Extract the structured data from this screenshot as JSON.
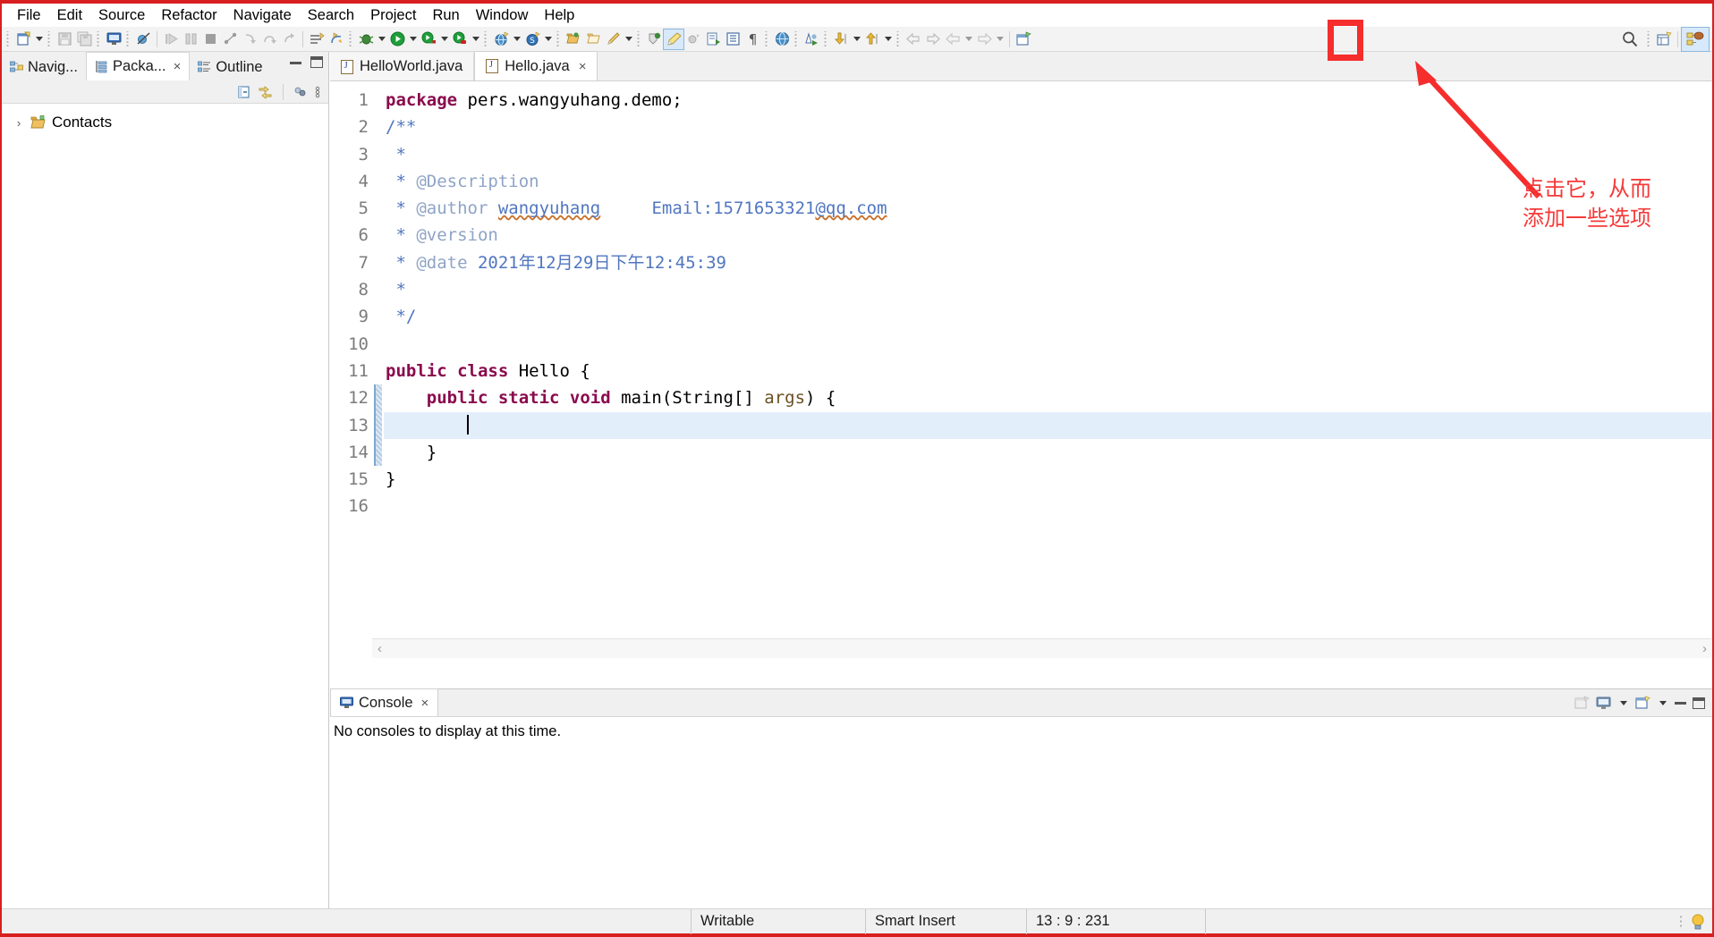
{
  "window": {
    "accent_border_color": "#d81f1f",
    "annotation_color": "#f53a3a"
  },
  "menubar": {
    "items": [
      {
        "label": "File"
      },
      {
        "label": "Edit"
      },
      {
        "label": "Source"
      },
      {
        "label": "Refactor"
      },
      {
        "label": "Navigate"
      },
      {
        "label": "Search"
      },
      {
        "label": "Project"
      },
      {
        "label": "Run"
      },
      {
        "label": "Window"
      },
      {
        "label": "Help"
      }
    ]
  },
  "annotation": {
    "line1": "点击它，从而",
    "line2": "添加一些选项"
  },
  "left_panel": {
    "tabs": [
      {
        "label": "Navig...",
        "icon": "navigator-icon",
        "active": false,
        "closable": false
      },
      {
        "label": "Packa...",
        "icon": "package-explorer-icon",
        "active": true,
        "closable": true
      },
      {
        "label": "Outline",
        "icon": "outline-icon",
        "active": false,
        "closable": false
      }
    ],
    "close_glyph": "×",
    "tree": [
      {
        "label": "Contacts",
        "arrow": "›",
        "icon": "project-folder-icon"
      }
    ]
  },
  "editor": {
    "tabs": [
      {
        "label": "HelloWorld.java",
        "active": false,
        "closable": false
      },
      {
        "label": "Hello.java",
        "active": true,
        "closable": true
      }
    ],
    "close_glyph": "×",
    "lines": [
      {
        "num": "1",
        "fold": false,
        "cursor": false,
        "segs": [
          {
            "t": "package",
            "c": "kw"
          },
          {
            "t": " pers.wangyuhang.demo;",
            "c": "txt"
          }
        ]
      },
      {
        "num": "2",
        "fold": true,
        "cursor": false,
        "segs": [
          {
            "t": "/**",
            "c": "cmt"
          }
        ]
      },
      {
        "num": "3",
        "fold": false,
        "cursor": false,
        "segs": [
          {
            "t": " *",
            "c": "cmt"
          }
        ]
      },
      {
        "num": "4",
        "fold": false,
        "cursor": false,
        "segs": [
          {
            "t": " * ",
            "c": "cmt"
          },
          {
            "t": "@Description",
            "c": "cmt-dim"
          }
        ]
      },
      {
        "num": "5",
        "fold": false,
        "cursor": false,
        "segs": [
          {
            "t": " * ",
            "c": "cmt"
          },
          {
            "t": "@author",
            "c": "cmt-dim"
          },
          {
            "t": " ",
            "c": "cmt"
          },
          {
            "t": "wangyuhang",
            "c": "cmt squig"
          },
          {
            "t": "     Email:1571653321",
            "c": "cmt"
          },
          {
            "t": "@qq.com",
            "c": "cmt squig"
          }
        ]
      },
      {
        "num": "6",
        "fold": false,
        "cursor": false,
        "segs": [
          {
            "t": " * ",
            "c": "cmt"
          },
          {
            "t": "@version",
            "c": "cmt-dim"
          }
        ]
      },
      {
        "num": "7",
        "fold": false,
        "cursor": false,
        "segs": [
          {
            "t": " * ",
            "c": "cmt"
          },
          {
            "t": "@date",
            "c": "cmt-dim"
          },
          {
            "t": " 2021年12月29日下午12:45:39",
            "c": "cmt"
          }
        ]
      },
      {
        "num": "8",
        "fold": false,
        "cursor": false,
        "segs": [
          {
            "t": " *",
            "c": "cmt"
          }
        ]
      },
      {
        "num": "9",
        "fold": false,
        "cursor": false,
        "segs": [
          {
            "t": " */",
            "c": "cmt"
          }
        ]
      },
      {
        "num": "10",
        "fold": false,
        "cursor": false,
        "segs": [
          {
            "t": "",
            "c": "txt"
          }
        ]
      },
      {
        "num": "11",
        "fold": false,
        "cursor": false,
        "segs": [
          {
            "t": "public class",
            "c": "kw"
          },
          {
            "t": " Hello {",
            "c": "txt"
          }
        ]
      },
      {
        "num": "12",
        "fold": true,
        "cursor": false,
        "segs": [
          {
            "t": "    ",
            "c": "txt"
          },
          {
            "t": "public static void",
            "c": "kw"
          },
          {
            "t": " main(String[] ",
            "c": "txt"
          },
          {
            "t": "args",
            "c": "param"
          },
          {
            "t": ") {",
            "c": "txt"
          }
        ]
      },
      {
        "num": "13",
        "fold": false,
        "cursor": true,
        "segs": [
          {
            "t": "        ",
            "c": "txt"
          }
        ]
      },
      {
        "num": "14",
        "fold": false,
        "cursor": false,
        "segs": [
          {
            "t": "    }",
            "c": "txt"
          }
        ]
      },
      {
        "num": "15",
        "fold": false,
        "cursor": false,
        "segs": [
          {
            "t": "}",
            "c": "txt"
          }
        ]
      },
      {
        "num": "16",
        "fold": false,
        "cursor": false,
        "segs": [
          {
            "t": "",
            "c": "txt"
          }
        ]
      }
    ],
    "scroll_left_glyph": "‹",
    "scroll_right_glyph": "›"
  },
  "console": {
    "tab_label": "Console",
    "close_glyph": "×",
    "message": "No consoles to display at this time."
  },
  "statusbar": {
    "writable": "Writable",
    "insert_mode": "Smart Insert",
    "position": "13 : 9 : 231"
  },
  "toolbar": {
    "groups": [
      {
        "items": [
          {
            "name": "new-wizard-button",
            "icon": "new-file-icon",
            "dropdown": true,
            "enabled": true
          },
          {
            "name": "save-button",
            "icon": "save-icon",
            "dropdown": false,
            "enabled": false
          },
          {
            "name": "save-all-button",
            "icon": "save-all-icon",
            "dropdown": false,
            "enabled": false
          }
        ]
      },
      {
        "items": [
          {
            "name": "open-console-button",
            "icon": "console-icon",
            "dropdown": false,
            "enabled": true
          }
        ]
      },
      {
        "items": [
          {
            "name": "toggle-breakpoint-button",
            "icon": "breakpoint-off-icon",
            "dropdown": false,
            "enabled": true
          }
        ]
      },
      {
        "items": [
          {
            "name": "resume-button",
            "icon": "resume-icon",
            "dropdown": false,
            "enabled": false
          },
          {
            "name": "suspend-button",
            "icon": "suspend-icon",
            "dropdown": false,
            "enabled": false
          },
          {
            "name": "terminate-button",
            "icon": "terminate-icon",
            "dropdown": false,
            "enabled": false
          },
          {
            "name": "disconnect-button",
            "icon": "disconnect-icon",
            "dropdown": false,
            "enabled": false
          },
          {
            "name": "step-into-button",
            "icon": "step-into-icon",
            "dropdown": false,
            "enabled": false
          },
          {
            "name": "step-over-button",
            "icon": "step-over-icon",
            "dropdown": false,
            "enabled": false
          },
          {
            "name": "step-return-button",
            "icon": "step-return-icon",
            "dropdown": false,
            "enabled": false
          }
        ]
      },
      {
        "items": [
          {
            "name": "new-java-package-button",
            "icon": "new-package-icon",
            "dropdown": false,
            "enabled": true
          },
          {
            "name": "new-java-class-button",
            "icon": "new-class-icon",
            "dropdown": false,
            "enabled": true
          }
        ]
      },
      {
        "items": [
          {
            "name": "debug-button",
            "icon": "debug-bug-icon",
            "dropdown": true,
            "enabled": true
          },
          {
            "name": "run-button",
            "icon": "run-play-icon",
            "dropdown": true,
            "enabled": true
          },
          {
            "name": "coverage-button",
            "icon": "coverage-icon",
            "dropdown": true,
            "enabled": true
          },
          {
            "name": "run-last-tool-button",
            "icon": "external-tools-icon",
            "dropdown": true,
            "enabled": true
          }
        ]
      },
      {
        "items": [
          {
            "name": "new-server-button",
            "icon": "globe-new-icon",
            "dropdown": true,
            "enabled": true
          },
          {
            "name": "new-spring-button",
            "icon": "spring-icon",
            "dropdown": true,
            "enabled": true
          }
        ]
      },
      {
        "items": [
          {
            "name": "open-type-button",
            "icon": "open-type-icon",
            "dropdown": false,
            "enabled": true
          },
          {
            "name": "open-task-button",
            "icon": "open-task-icon",
            "dropdown": false,
            "enabled": true
          },
          {
            "name": "edit-button",
            "icon": "pencil-icon",
            "dropdown": true,
            "enabled": true
          }
        ]
      },
      {
        "items": [
          {
            "name": "search-type-button",
            "icon": "search-type-icon",
            "dropdown": false,
            "enabled": true
          },
          {
            "name": "mark-occurrences-button",
            "icon": "highlight-marker-icon",
            "dropdown": false,
            "enabled": true,
            "selected": true
          },
          {
            "name": "skip-breakpoints-button",
            "icon": "skip-breakpoints-icon",
            "dropdown": false,
            "enabled": false
          },
          {
            "name": "show-source-button",
            "icon": "show-source-icon",
            "dropdown": false,
            "enabled": true
          },
          {
            "name": "show-whitespace-button",
            "icon": "show-whitespace-icon",
            "dropdown": false,
            "enabled": true
          },
          {
            "name": "pilcrow-button",
            "icon": "pilcrow-icon",
            "dropdown": false,
            "enabled": true
          }
        ]
      },
      {
        "items": [
          {
            "name": "open-web-browser-button",
            "icon": "web-browser-icon",
            "dropdown": false,
            "enabled": true
          }
        ]
      },
      {
        "items": [
          {
            "name": "run-as-button",
            "icon": "run-as-icon",
            "dropdown": false,
            "enabled": true
          }
        ]
      },
      {
        "items": [
          {
            "name": "next-annotation-button",
            "icon": "next-annotation-icon",
            "dropdown": true,
            "enabled": true
          },
          {
            "name": "previous-annotation-button",
            "icon": "previous-annotation-icon",
            "dropdown": true,
            "enabled": true
          }
        ]
      },
      {
        "items": [
          {
            "name": "back-button",
            "icon": "back-arrow-icon",
            "dropdown": false,
            "enabled": false
          },
          {
            "name": "forward-button",
            "icon": "forward-arrow-icon",
            "dropdown": false,
            "enabled": false
          },
          {
            "name": "previous-edit-button",
            "icon": "prev-edit-icon",
            "dropdown": true,
            "enabled": false
          },
          {
            "name": "next-edit-button",
            "icon": "next-edit-icon",
            "dropdown": true,
            "enabled": false
          }
        ]
      },
      {
        "items": [
          {
            "name": "new-window-button",
            "icon": "new-window-icon",
            "dropdown": false,
            "enabled": true
          }
        ]
      }
    ],
    "right_items": [
      {
        "name": "quick-access-search-button",
        "icon": "search-icon",
        "highlighted": true
      },
      {
        "name": "open-perspective-button",
        "icon": "open-perspective-icon",
        "highlighted": false
      },
      {
        "name": "java-perspective-button",
        "icon": "java-perspective-icon",
        "highlighted": false,
        "selected": true
      }
    ]
  }
}
